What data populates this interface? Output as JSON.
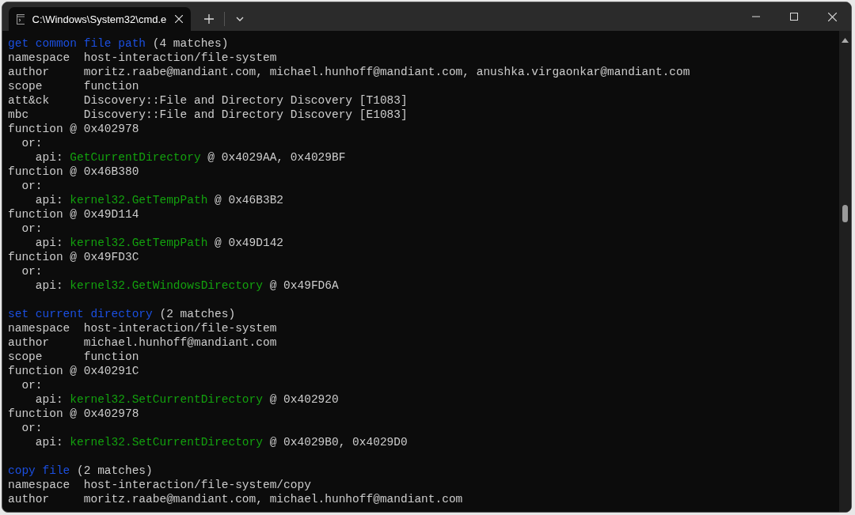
{
  "tabs": [
    {
      "label": "C:\\Windows\\System32\\cmd.e",
      "selected": true
    }
  ],
  "blocks": [
    {
      "lines": [
        [
          {
            "text": "get common file path",
            "kind": "heading"
          },
          {
            "text": " (4 matches)",
            "kind": "plain"
          }
        ],
        [
          {
            "text": "namespace  host-interaction/file-system",
            "kind": "plain"
          }
        ],
        [
          {
            "text": "author     moritz.raabe@mandiant.com, michael.hunhoff@mandiant.com, anushka.virgaonkar@mandiant.com",
            "kind": "plain"
          }
        ],
        [
          {
            "text": "scope      function",
            "kind": "plain"
          }
        ],
        [
          {
            "text": "att&ck     Discovery::File and Directory Discovery [T1083]",
            "kind": "plain"
          }
        ],
        [
          {
            "text": "mbc        Discovery::File and Directory Discovery [E1083]",
            "kind": "plain"
          }
        ],
        [
          {
            "text": "function @ 0x402978",
            "kind": "plain"
          }
        ],
        [
          {
            "text": "  or:",
            "kind": "plain"
          }
        ],
        [
          {
            "text": "    api: ",
            "kind": "plain"
          },
          {
            "text": "GetCurrentDirectory",
            "kind": "api"
          },
          {
            "text": " @ 0x4029AA, 0x4029BF",
            "kind": "plain"
          }
        ],
        [
          {
            "text": "function @ 0x46B380",
            "kind": "plain"
          }
        ],
        [
          {
            "text": "  or:",
            "kind": "plain"
          }
        ],
        [
          {
            "text": "    api: ",
            "kind": "plain"
          },
          {
            "text": "kernel32.GetTempPath",
            "kind": "api"
          },
          {
            "text": " @ 0x46B3B2",
            "kind": "plain"
          }
        ],
        [
          {
            "text": "function @ 0x49D114",
            "kind": "plain"
          }
        ],
        [
          {
            "text": "  or:",
            "kind": "plain"
          }
        ],
        [
          {
            "text": "    api: ",
            "kind": "plain"
          },
          {
            "text": "kernel32.GetTempPath",
            "kind": "api"
          },
          {
            "text": " @ 0x49D142",
            "kind": "plain"
          }
        ],
        [
          {
            "text": "function @ 0x49FD3C",
            "kind": "plain"
          }
        ],
        [
          {
            "text": "  or:",
            "kind": "plain"
          }
        ],
        [
          {
            "text": "    api: ",
            "kind": "plain"
          },
          {
            "text": "kernel32.GetWindowsDirectory",
            "kind": "api"
          },
          {
            "text": " @ 0x49FD6A",
            "kind": "plain"
          }
        ]
      ]
    },
    {
      "lines": [
        [
          {
            "text": "set current directory",
            "kind": "heading"
          },
          {
            "text": " (2 matches)",
            "kind": "plain"
          }
        ],
        [
          {
            "text": "namespace  host-interaction/file-system",
            "kind": "plain"
          }
        ],
        [
          {
            "text": "author     michael.hunhoff@mandiant.com",
            "kind": "plain"
          }
        ],
        [
          {
            "text": "scope      function",
            "kind": "plain"
          }
        ],
        [
          {
            "text": "function @ 0x40291C",
            "kind": "plain"
          }
        ],
        [
          {
            "text": "  or:",
            "kind": "plain"
          }
        ],
        [
          {
            "text": "    api: ",
            "kind": "plain"
          },
          {
            "text": "kernel32.SetCurrentDirectory",
            "kind": "api"
          },
          {
            "text": " @ 0x402920",
            "kind": "plain"
          }
        ],
        [
          {
            "text": "function @ 0x402978",
            "kind": "plain"
          }
        ],
        [
          {
            "text": "  or:",
            "kind": "plain"
          }
        ],
        [
          {
            "text": "    api: ",
            "kind": "plain"
          },
          {
            "text": "kernel32.SetCurrentDirectory",
            "kind": "api"
          },
          {
            "text": " @ 0x4029B0, 0x4029D0",
            "kind": "plain"
          }
        ]
      ]
    },
    {
      "lines": [
        [
          {
            "text": "copy file",
            "kind": "heading"
          },
          {
            "text": " (2 matches)",
            "kind": "plain"
          }
        ],
        [
          {
            "text": "namespace  host-interaction/file-system/copy",
            "kind": "plain"
          }
        ],
        [
          {
            "text": "author     moritz.raabe@mandiant.com, michael.hunhoff@mandiant.com",
            "kind": "plain"
          }
        ]
      ]
    }
  ]
}
